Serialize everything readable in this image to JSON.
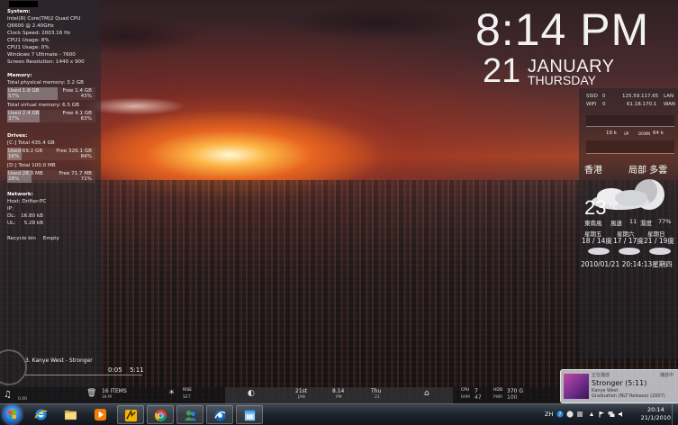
{
  "system": {
    "heading": "System:",
    "lines": [
      "Intel(R) Core(TM)2 Quad CPU    Q6600 @ 2.40GHz",
      "Clock Speed: 2003.16 Hz",
      "CPU1 Usage: 8%",
      "CPU1 Usage: 0%",
      "Windows 7 Ultimate - 7600",
      "Screen Resolution: 1440 x 900"
    ],
    "memory_heading": "Memory:",
    "phys_label": "Total physical memory: 3.2 GB",
    "phys_used": "Used 1.8 GB",
    "phys_free": "Free 1.4 GB",
    "phys_used_pct": "57%",
    "phys_free_pct": "43%",
    "virt_label": "Total virtual memory: 6.5 GB",
    "virt_used": "Used 2.4 GB",
    "virt_free": "Free 4.1 GB",
    "virt_used_pct": "37%",
    "virt_free_pct": "63%",
    "drives_heading": "Drives:",
    "c_label": "[C:] Total 435.4 GB",
    "c_used": "Used 69.2 GB",
    "c_free": "Free 326.1 GB",
    "c_used_pct": "16%",
    "c_free_pct": "84%",
    "d_label": "[D:] Total 100.0 MB",
    "d_used": "Used 28.3 MB",
    "d_free": "Free 71.7 MB",
    "d_used_pct": "28%",
    "d_free_pct": "71%",
    "network_heading": "Network:",
    "host": "Host: Drifter-PC",
    "ip": "IP:",
    "dl": "DL:",
    "dl_val": "16.80 kB",
    "ul": "UL:",
    "ul_val": "5.28 kB",
    "recycle": [
      "Recycle bin",
      "Empty"
    ]
  },
  "clock": {
    "time": "8:14 PM",
    "day": "21",
    "month": "JANUARY",
    "weekday": "THURSDAY"
  },
  "net_panel": {
    "ssid_label": "SSID",
    "ssid_val": "0",
    "ssid_ip": "125.59.117.65",
    "ssid_tag": "LAN",
    "wifi_label": "WiFi",
    "wifi_val": "0",
    "wifi_ip": "61.18.170.1",
    "wifi_tag": "WAN",
    "speed_up": "19 k",
    "speed_up_label": "UP",
    "speed_down_label": "DOWN",
    "speed_down": "64 k"
  },
  "weather": {
    "city": "香港",
    "condition": "局部 多雲",
    "temp": "23",
    "unit": "°C",
    "wind_label": "東南風",
    "wind_speed_label": "風速",
    "wind_speed": "11",
    "humidity_label": "濕度",
    "humidity": "77%",
    "forecast_days": [
      "星期五",
      "星期六",
      "星期日"
    ],
    "forecast_temps": [
      "18 / 14度",
      "17 / 17度",
      "21 / 19度"
    ],
    "timestamp": "2010/01/21 20:14:13星期四"
  },
  "media": {
    "track": "3. Kanye West - Stronger",
    "elapsed": "0:05",
    "total": "5:11"
  },
  "dock": {
    "vol": "0.00",
    "items": "16 ITEMS",
    "items_sub": "34 M",
    "rise": "RISE",
    "rise_sub": "SET",
    "date_num": "21st",
    "date_sub": "JAN",
    "time": "8.14",
    "time_sub": "PM",
    "weekday": "Thu",
    "weekday_sub": "21",
    "cpu_label": "CPU",
    "cpu_val": "7",
    "ram_label": "RAM",
    "ram_val": "47",
    "hdd_label": "HDD",
    "hdd_val": "370 G",
    "pwr_label": "PWR",
    "pwr_val": "100"
  },
  "now_playing": {
    "header_left": "正在播放",
    "header_right": "播放中",
    "title": "Stronger (5:11)",
    "artist": "Kanye West",
    "album": "Graduation (NLT Release) (2007)"
  },
  "taskbar": {
    "apps": [
      "internet-explorer-icon",
      "folder-icon",
      "media-player-icon",
      "winamp-icon",
      "chrome-icon",
      "messenger-icon",
      "ie-alt-icon",
      "window-icon"
    ],
    "lang": "ZH",
    "clock_time": "20:14",
    "clock_date": "21/1/2010"
  }
}
